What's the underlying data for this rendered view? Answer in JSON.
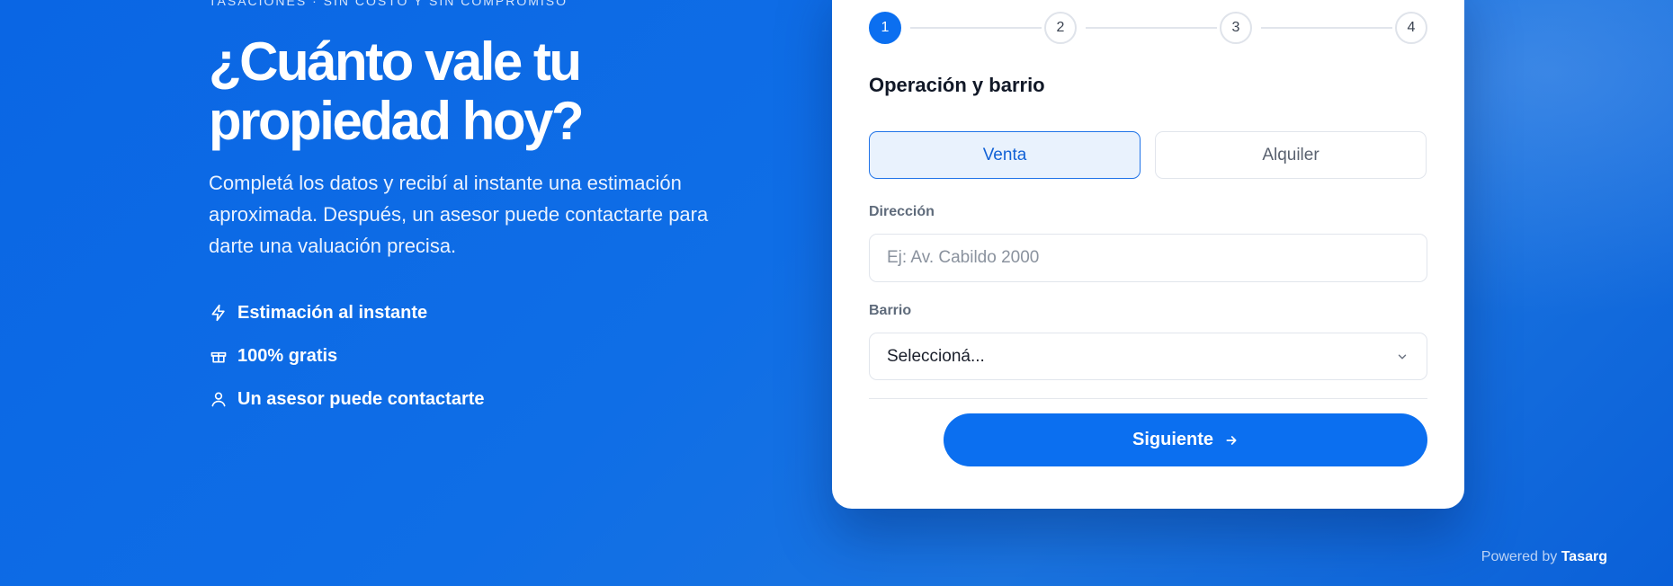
{
  "hero": {
    "eyebrow": "TASACIONES · SIN COSTO Y SIN COMPROMISO",
    "title": "¿Cuánto vale tu propiedad hoy?",
    "lead": "Completá los datos y recibí al instante una estimación aproximada. Después, un asesor puede contactarte para darte una valuación precisa.",
    "features": [
      {
        "icon": "lightning-icon",
        "label": "Estimación al instante"
      },
      {
        "icon": "gift-icon",
        "label": "100% gratis"
      },
      {
        "icon": "user-icon",
        "label": "Un asesor puede contactarte"
      }
    ]
  },
  "form": {
    "steps": [
      "1",
      "2",
      "3",
      "4"
    ],
    "current_step": 1,
    "section_title": "Operación y barrio",
    "operation": {
      "options": [
        "Venta",
        "Alquiler"
      ],
      "selected": "Venta"
    },
    "address": {
      "label": "Dirección",
      "placeholder": "Ej: Av. Cabildo 2000",
      "value": ""
    },
    "barrio": {
      "label": "Barrio",
      "value": "Seleccioná..."
    },
    "next_label": "Siguiente"
  },
  "footer": {
    "powered_by": "Powered by",
    "brand": "Tasarg"
  },
  "colors": {
    "primary": "#0b6ff0",
    "background": "#0a66e4"
  }
}
